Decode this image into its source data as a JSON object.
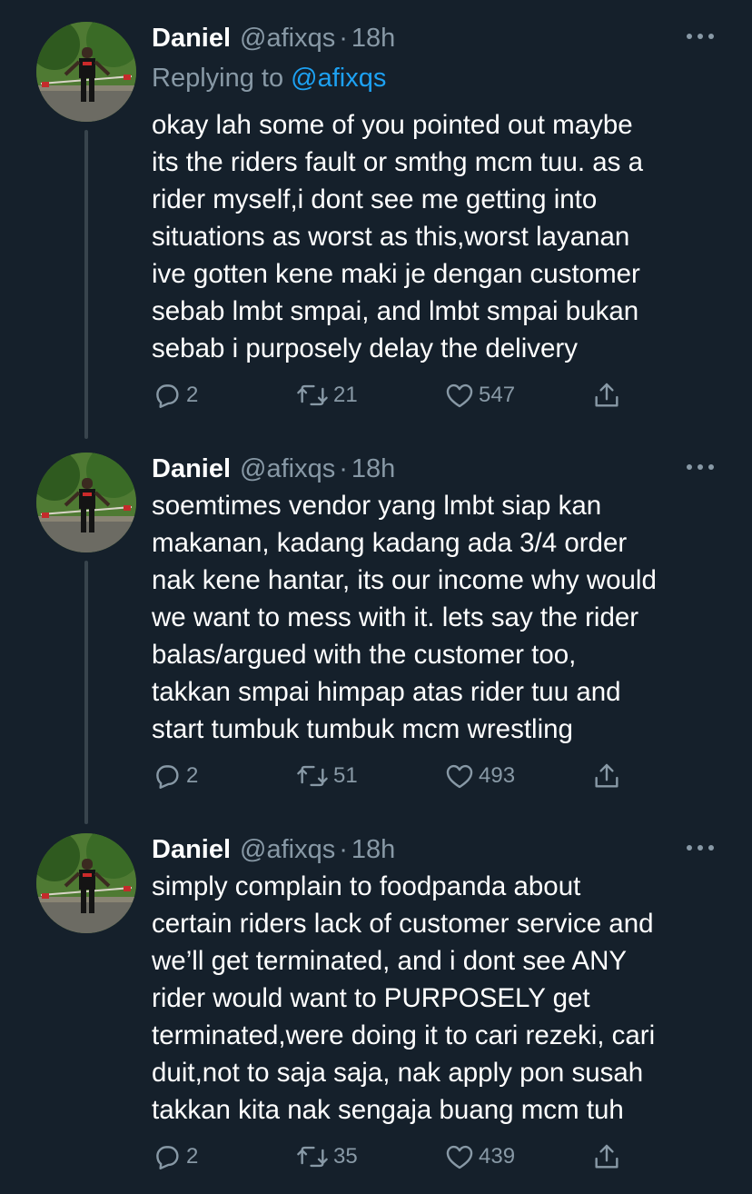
{
  "tweets": [
    {
      "name": "Daniel",
      "handle": "@afixqs",
      "dot": "·",
      "time": "18h",
      "replying_prefix": "Replying to ",
      "replying_mention": "@afixqs",
      "text": "okay lah some of you pointed out maybe\nits the riders fault or smthg mcm tuu. as a\nrider myself,i dont see me getting into\nsituations as worst as this,worst layanan\nive gotten kene maki je dengan customer\nsebab lmbt smpai, and lmbt smpai bukan\nsebab i purposely delay the delivery",
      "replies": "2",
      "retweets": "21",
      "likes": "547"
    },
    {
      "name": "Daniel",
      "handle": "@afixqs",
      "dot": "·",
      "time": "18h",
      "text": "soemtimes vendor yang lmbt siap kan\nmakanan, kadang kadang ada 3/4 order\nnak kene hantar, its our income why would\nwe want to mess with it. lets say the rider\nbalas/argued with the customer too,\ntakkan smpai himpap atas rider tuu and\nstart tumbuk tumbuk mcm wrestling",
      "replies": "2",
      "retweets": "51",
      "likes": "493"
    },
    {
      "name": "Daniel",
      "handle": "@afixqs",
      "dot": "·",
      "time": "18h",
      "text": "simply complain to foodpanda about\ncertain riders lack of customer service and\nwe’ll get terminated, and i dont see ANY\nrider would want to PURPOSELY get\nterminated,were doing it to cari rezeki, cari\nduit,not to saja saja, nak apply pon susah\ntakkan kita nak sengaja buang mcm tuh",
      "replies": "2",
      "retweets": "35",
      "likes": "439"
    }
  ],
  "icons": {
    "reply": "reply-icon",
    "retweet": "retweet-icon",
    "like": "heart-icon",
    "share": "share-icon",
    "more": "more-icon"
  },
  "colors": {
    "background": "#15202b",
    "text": "#ffffff",
    "secondary": "#8899a6",
    "link": "#1da1f2",
    "thread_line": "#38444d"
  }
}
